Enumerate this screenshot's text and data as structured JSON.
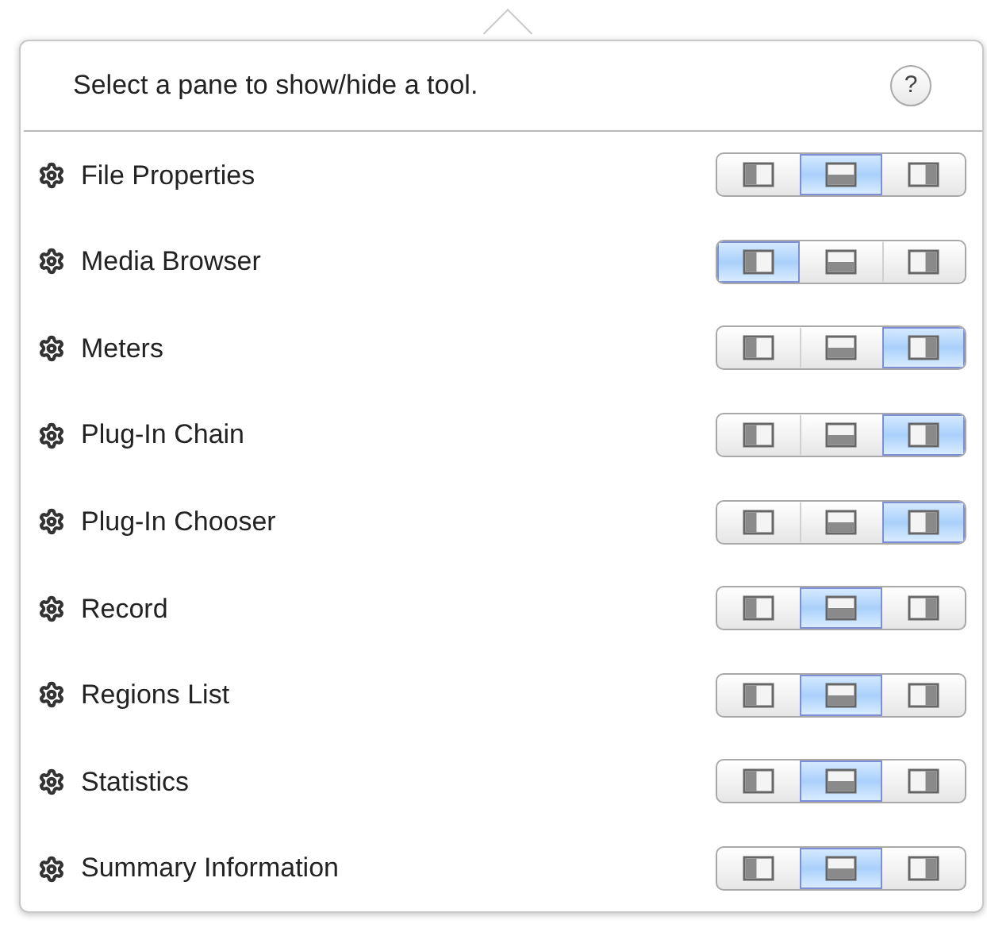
{
  "header": {
    "instruction": "Select a pane to show/hide a tool.",
    "help": "?"
  },
  "tools": [
    {
      "name": "File Properties",
      "panes": [
        {
          "kind": "left",
          "selected": false
        },
        {
          "kind": "bottom",
          "selected": true
        },
        {
          "kind": "right",
          "selected": false
        }
      ]
    },
    {
      "name": "Media Browser",
      "panes": [
        {
          "kind": "left",
          "selected": true
        },
        {
          "kind": "bottom",
          "selected": false
        },
        {
          "kind": "right",
          "selected": false
        }
      ]
    },
    {
      "name": "Meters",
      "panes": [
        {
          "kind": "left",
          "selected": false
        },
        {
          "kind": "bottom",
          "selected": false
        },
        {
          "kind": "right",
          "selected": true
        }
      ]
    },
    {
      "name": "Plug-In Chain",
      "panes": [
        {
          "kind": "left",
          "selected": false
        },
        {
          "kind": "bottom",
          "selected": false
        },
        {
          "kind": "right",
          "selected": true
        }
      ]
    },
    {
      "name": "Plug-In Chooser",
      "panes": [
        {
          "kind": "left",
          "selected": false
        },
        {
          "kind": "bottom",
          "selected": false
        },
        {
          "kind": "right",
          "selected": true
        }
      ]
    },
    {
      "name": "Record",
      "panes": [
        {
          "kind": "left",
          "selected": false
        },
        {
          "kind": "bottom",
          "selected": true
        },
        {
          "kind": "right",
          "selected": false
        }
      ]
    },
    {
      "name": "Regions List",
      "panes": [
        {
          "kind": "left",
          "selected": false
        },
        {
          "kind": "bottom",
          "selected": true
        },
        {
          "kind": "right",
          "selected": false
        }
      ]
    },
    {
      "name": "Statistics",
      "panes": [
        {
          "kind": "left",
          "selected": false
        },
        {
          "kind": "bottom",
          "selected": true
        },
        {
          "kind": "right",
          "selected": false
        }
      ]
    },
    {
      "name": "Summary Information",
      "panes": [
        {
          "kind": "left",
          "selected": false
        },
        {
          "kind": "bottom",
          "selected": true
        },
        {
          "kind": "right",
          "selected": false
        }
      ]
    }
  ]
}
